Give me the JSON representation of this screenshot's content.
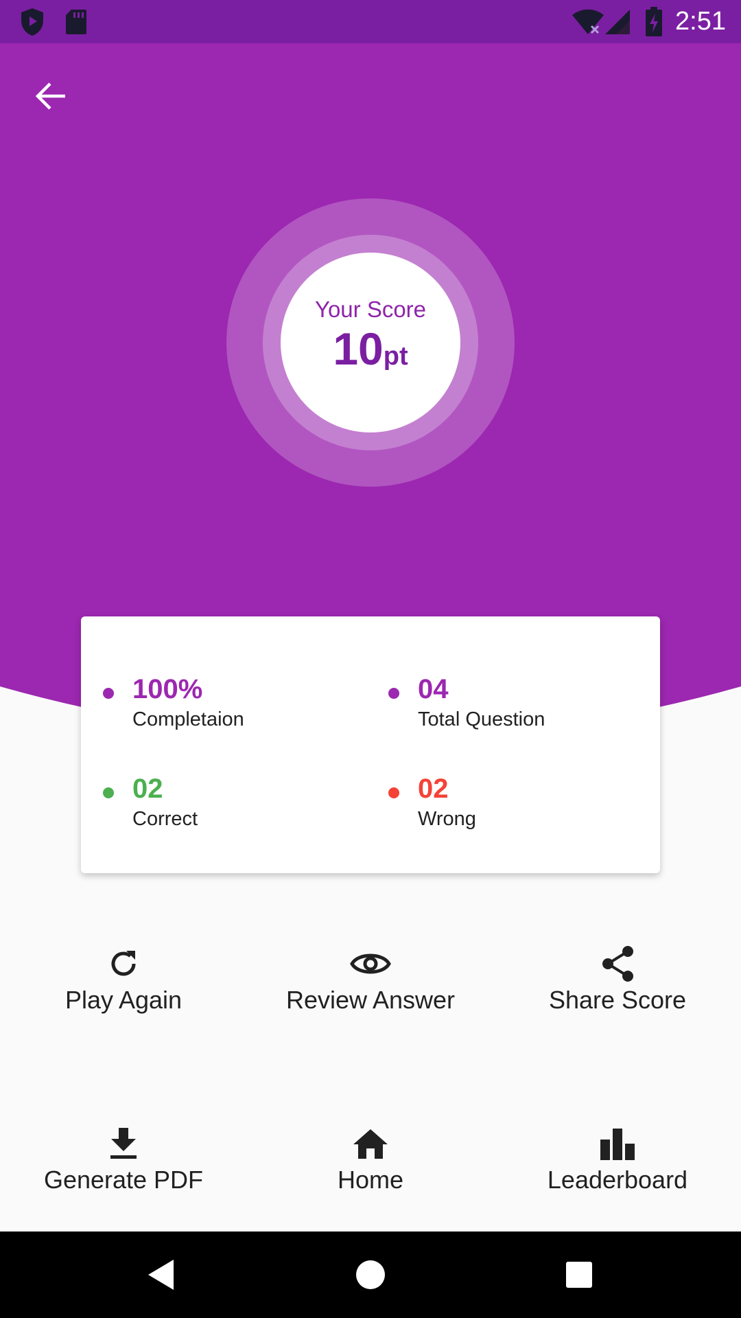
{
  "colors": {
    "primary": "#9C27B0",
    "primary_dark": "#7B1FA2",
    "correct": "#4CAF50",
    "wrong": "#F44336",
    "background": "#FAFAFA"
  },
  "status_bar": {
    "time": "2:51",
    "icons": [
      "shield-play-icon",
      "sd-card-icon",
      "wifi-off-icon",
      "signal-icon",
      "battery-charging-icon"
    ]
  },
  "header": {
    "back_icon": "arrow-back-icon"
  },
  "score": {
    "label": "Your Score",
    "value": "10",
    "unit": "pt"
  },
  "stats": {
    "completion": {
      "value": "100%",
      "label": "Completaion"
    },
    "total": {
      "value": "04",
      "label": "Total Question"
    },
    "correct": {
      "value": "02",
      "label": "Correct"
    },
    "wrong": {
      "value": "02",
      "label": "Wrong"
    }
  },
  "actions": {
    "play_again": {
      "label": "Play Again",
      "icon": "refresh-icon"
    },
    "review_answer": {
      "label": "Review Answer",
      "icon": "eye-icon"
    },
    "share_score": {
      "label": "Share Score",
      "icon": "share-icon"
    },
    "generate_pdf": {
      "label": "Generate PDF",
      "icon": "download-icon"
    },
    "home": {
      "label": "Home",
      "icon": "home-icon"
    },
    "leaderboard": {
      "label": "Leaderboard",
      "icon": "bar-chart-icon"
    }
  },
  "nav_bar": {
    "icons": [
      "nav-back-icon",
      "nav-home-icon",
      "nav-recents-icon"
    ]
  }
}
